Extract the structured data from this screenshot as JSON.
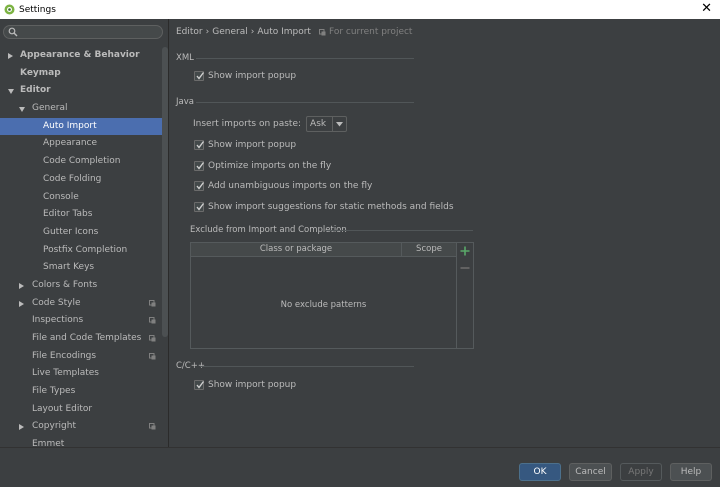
{
  "window": {
    "title": "Settings",
    "close_glyph": "✕"
  },
  "search": {
    "value": "",
    "placeholder": ""
  },
  "sidebar": {
    "items": [
      {
        "label": "Appearance & Behavior",
        "level": 0,
        "arrow": "right",
        "bold": true
      },
      {
        "label": "Keymap",
        "level": 0,
        "arrow": "",
        "bold": true
      },
      {
        "label": "Editor",
        "level": 0,
        "arrow": "down",
        "bold": true
      },
      {
        "label": "General",
        "level": 1,
        "arrow": "down"
      },
      {
        "label": "Auto Import",
        "level": 2,
        "arrow": "",
        "selected": true
      },
      {
        "label": "Appearance",
        "level": 2,
        "arrow": ""
      },
      {
        "label": "Code Completion",
        "level": 2,
        "arrow": ""
      },
      {
        "label": "Code Folding",
        "level": 2,
        "arrow": ""
      },
      {
        "label": "Console",
        "level": 2,
        "arrow": ""
      },
      {
        "label": "Editor Tabs",
        "level": 2,
        "arrow": ""
      },
      {
        "label": "Gutter Icons",
        "level": 2,
        "arrow": ""
      },
      {
        "label": "Postfix Completion",
        "level": 2,
        "arrow": ""
      },
      {
        "label": "Smart Keys",
        "level": 2,
        "arrow": ""
      },
      {
        "label": "Colors & Fonts",
        "level": 1,
        "arrow": "right"
      },
      {
        "label": "Code Style",
        "level": 1,
        "arrow": "right",
        "project": true
      },
      {
        "label": "Inspections",
        "level": 1,
        "arrow": "",
        "project": true
      },
      {
        "label": "File and Code Templates",
        "level": 1,
        "arrow": "",
        "project": true
      },
      {
        "label": "File Encodings",
        "level": 1,
        "arrow": "",
        "project": true
      },
      {
        "label": "Live Templates",
        "level": 1,
        "arrow": ""
      },
      {
        "label": "File Types",
        "level": 1,
        "arrow": ""
      },
      {
        "label": "Layout Editor",
        "level": 1,
        "arrow": ""
      },
      {
        "label": "Copyright",
        "level": 1,
        "arrow": "right",
        "project": true
      },
      {
        "label": "Emmet",
        "level": 1,
        "arrow": ""
      }
    ]
  },
  "breadcrumb": {
    "parts": [
      "Editor",
      "General",
      "Auto Import"
    ],
    "separator": "›",
    "project_note": "For current project"
  },
  "xml": {
    "section": "XML",
    "show_import_popup": {
      "label": "Show import popup",
      "checked": true
    }
  },
  "java": {
    "section": "Java",
    "insert_label": "Insert imports on paste:",
    "insert_value": "Ask",
    "options": [
      {
        "label": "Show import popup",
        "checked": true
      },
      {
        "label": "Optimize imports on the fly",
        "checked": true
      },
      {
        "label": "Add unambiguous imports on the fly",
        "checked": true
      },
      {
        "label": "Show import suggestions for static methods and fields",
        "checked": true
      }
    ],
    "exclude": {
      "title": "Exclude from Import and Completion",
      "columns": [
        "Class or package",
        "Scope"
      ],
      "empty_text": "No exclude patterns"
    }
  },
  "cpp": {
    "section": "C/C++",
    "show_import_popup": {
      "label": "Show import popup",
      "checked": true
    }
  },
  "footer": {
    "ok": "OK",
    "cancel": "Cancel",
    "apply": "Apply",
    "help": "Help"
  },
  "colors": {
    "background": "#3c3f41",
    "selection": "#4b6eaf",
    "ok_button": "#365880",
    "add_icon": "#59a869"
  }
}
